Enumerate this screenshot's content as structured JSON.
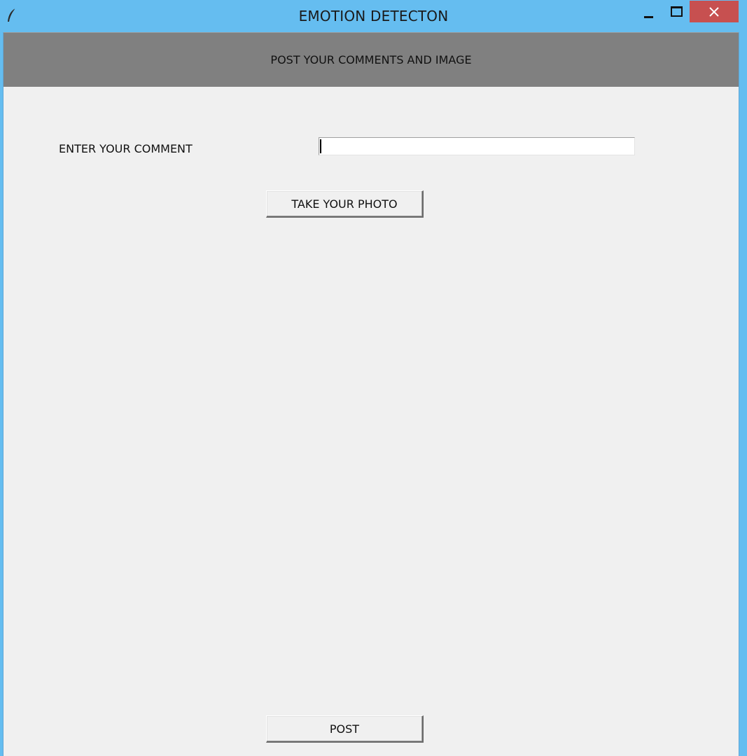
{
  "window": {
    "title": "EMOTION DETECTON",
    "icon": "feather-icon",
    "controls": {
      "minimize": "minimize-icon",
      "maximize": "maximize-icon",
      "close": "close-icon"
    }
  },
  "header": {
    "text": "POST YOUR COMMENTS AND IMAGE"
  },
  "form": {
    "comment_label": "ENTER YOUR COMMENT",
    "comment_value": "",
    "photo_button_label": "TAKE YOUR PHOTO",
    "post_button_label": "POST"
  },
  "colors": {
    "titlebar": "#65bdf0",
    "header_band": "#808080",
    "client_bg": "#f0f0f0",
    "close_button": "#c75050"
  }
}
